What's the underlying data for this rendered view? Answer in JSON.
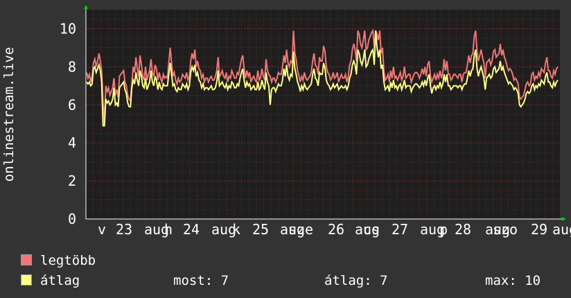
{
  "chart_data": {
    "type": "line",
    "ylabel": "onlinestream.live",
    "ylim": [
      0,
      11
    ],
    "y_ticks": [
      "0",
      "2",
      "4",
      "6",
      "8",
      "10"
    ],
    "x_ticks": [
      "v",
      "23",
      "aug",
      "h",
      "24",
      "aug",
      "k",
      "25",
      "aug",
      "sze",
      "26",
      "aug",
      "cs",
      "27",
      "aug",
      "p",
      "28",
      "aug",
      "szo",
      "29",
      "aug"
    ],
    "grid": true,
    "colors": {
      "background": "#333333",
      "plot": "#1e1e1e",
      "grid": "#5a2a2a",
      "axis": "#ffffff",
      "arrow": "#00cc00"
    },
    "series": [
      {
        "name": "legtöbb",
        "color": "#f07878",
        "values": [
          7.7,
          7.4,
          7.6,
          7.2,
          7.5,
          8.2,
          8.4,
          8.0,
          8.3,
          8.7,
          8.3,
          7.8,
          6.1,
          5.1,
          7.0,
          6.7,
          6.9,
          6.5,
          6.7,
          6.9,
          7.4,
          6.5,
          6.8,
          6.4,
          7.5,
          7.6,
          7.7,
          7.8,
          7.2,
          7.0,
          6.5,
          6.3,
          6.2,
          7.1,
          8.0,
          7.7,
          8.5,
          7.9,
          7.5,
          8.6,
          8.1,
          7.5,
          7.3,
          8.0,
          7.3,
          7.6,
          7.8,
          8.4,
          7.7,
          7.5,
          8.1,
          7.9,
          7.3,
          7.7,
          7.4,
          7.2,
          7.6,
          7.4,
          7.5,
          7.4,
          8.2,
          9.0,
          8.2,
          7.5,
          7.7,
          7.3,
          7.1,
          7.4,
          7.2,
          7.3,
          7.6,
          7.5,
          7.4,
          7.7,
          7.3,
          7.5,
          8.3,
          8.7,
          8.4,
          8.9,
          8.0,
          8.3,
          7.9,
          7.8,
          7.4,
          7.6,
          7.2,
          7.4,
          7.4,
          7.2,
          7.4,
          7.5,
          7.3,
          7.3,
          7.5,
          7.8,
          8.5,
          7.5,
          7.6,
          7.8,
          7.5,
          7.4,
          7.7,
          7.2,
          7.5,
          7.4,
          7.8,
          7.6,
          7.4,
          7.4,
          7.7,
          7.6,
          8.0,
          8.4,
          8.6,
          7.9,
          7.4,
          7.8,
          7.5,
          7.7,
          7.2,
          7.4,
          7.5,
          7.3,
          7.2,
          7.8,
          7.3,
          7.4,
          7.9,
          7.5,
          7.3,
          8.4,
          7.8,
          7.6,
          7.5,
          7.2,
          7.4,
          7.4,
          7.2,
          7.4,
          7.7,
          7.6,
          7.6,
          8.0,
          8.6,
          8.2,
          8.9,
          8.2,
          8.0,
          8.3,
          8.2,
          9.9,
          8.7,
          8.4,
          7.8,
          7.5,
          7.2,
          7.5,
          7.3,
          7.7,
          7.4,
          7.3,
          7.4,
          7.5,
          7.7,
          8.3,
          8.7,
          8.1,
          8.0,
          7.6,
          8.5,
          8.3,
          8.3,
          9.1,
          8.8,
          8.0,
          7.7,
          7.6,
          7.3,
          7.4,
          7.7,
          7.4,
          7.5,
          7.7,
          7.2,
          7.4,
          7.6,
          7.4,
          7.4,
          7.6,
          7.2,
          7.5,
          8.1,
          8.3,
          8.9,
          9.2,
          8.9,
          8.3,
          9.9,
          9.7,
          9.2,
          9.0,
          9.4,
          9.9,
          8.9,
          9.0,
          9.4,
          9.6,
          9.8,
          9.9,
          9.0,
          9.9,
          9.7,
          9.4,
          9.9,
          8.7,
          9.0,
          7.8,
          7.3,
          7.4,
          7.6,
          7.2,
          7.8,
          7.4,
          8.0,
          7.4,
          7.5,
          7.3,
          7.5,
          7.7,
          7.3,
          7.5,
          8.0,
          7.4,
          7.5,
          7.6,
          7.6,
          7.2,
          7.4,
          7.6,
          7.7,
          7.7,
          7.6,
          7.4,
          7.6,
          7.9,
          7.6,
          8.0,
          7.5,
          8.1,
          8.3,
          7.5,
          7.2,
          7.4,
          7.6,
          7.3,
          7.6,
          7.4,
          7.8,
          7.4,
          7.7,
          8.4,
          7.8,
          8.3,
          7.6,
          7.6,
          7.3,
          7.4,
          7.6,
          7.6,
          7.5,
          7.4,
          7.6,
          7.6,
          7.2,
          7.6,
          7.7,
          7.7,
          8.1,
          8.6,
          8.2,
          8.6,
          8.7,
          9.6,
          9.9,
          8.8,
          8.3,
          8.6,
          8.9,
          8.5,
          8.2,
          7.4,
          8.2,
          8.3,
          8.4,
          8.1,
          8.3,
          8.8,
          8.9,
          8.5,
          8.6,
          8.7,
          9.2,
          8.6,
          8.9,
          8.5,
          8.3,
          8.0,
          7.8,
          7.9,
          7.8,
          7.6,
          7.3,
          7.4,
          7.3,
          7.1,
          6.4,
          6.3,
          6.4,
          6.5,
          6.8,
          7.1,
          7.2,
          7.0,
          7.1,
          7.6,
          7.7,
          7.3,
          7.5,
          7.4,
          7.7,
          7.5,
          7.9,
          7.8,
          7.7,
          8.2,
          8.5,
          7.8,
          7.8,
          7.5,
          7.4,
          7.8,
          7.6,
          7.9,
          8.0
        ]
      },
      {
        "name": "átlag",
        "color": "#ffff88",
        "values": [
          7.2,
          7.1,
          7.2,
          7.0,
          7.1,
          7.9,
          8.0,
          7.7,
          7.9,
          8.1,
          7.8,
          7.2,
          4.9,
          4.9,
          6.3,
          6.1,
          6.2,
          6.0,
          6.1,
          6.3,
          6.9,
          6.0,
          6.1,
          5.9,
          6.9,
          7.0,
          7.1,
          7.2,
          6.8,
          6.6,
          6.1,
          5.9,
          5.9,
          6.9,
          7.3,
          7.1,
          7.7,
          7.3,
          7.0,
          7.8,
          7.5,
          7.0,
          6.9,
          7.4,
          6.8,
          7.0,
          7.2,
          7.8,
          7.2,
          7.0,
          7.5,
          7.3,
          6.8,
          7.2,
          6.9,
          6.8,
          7.1,
          7.0,
          7.0,
          7.0,
          7.6,
          8.2,
          7.6,
          7.0,
          7.1,
          6.8,
          6.7,
          6.9,
          6.8,
          6.8,
          7.1,
          7.0,
          6.9,
          7.1,
          6.8,
          7.0,
          7.7,
          8.0,
          7.8,
          8.1,
          7.5,
          7.7,
          7.3,
          7.2,
          6.9,
          7.1,
          6.8,
          6.9,
          6.9,
          6.8,
          6.9,
          7.0,
          6.8,
          6.8,
          6.9,
          7.2,
          7.8,
          7.0,
          7.1,
          7.2,
          7.0,
          6.9,
          7.1,
          6.8,
          7.0,
          6.9,
          7.2,
          7.1,
          6.9,
          6.9,
          7.1,
          7.0,
          7.4,
          7.7,
          7.9,
          7.3,
          6.9,
          7.2,
          7.0,
          7.1,
          6.8,
          6.9,
          7.0,
          6.8,
          6.8,
          7.2,
          6.8,
          6.9,
          7.3,
          7.0,
          6.8,
          7.7,
          7.2,
          7.0,
          6.0,
          6.8,
          6.9,
          6.9,
          6.7,
          6.9,
          7.1,
          7.0,
          7.0,
          7.3,
          7.9,
          7.5,
          8.1,
          7.5,
          7.3,
          7.6,
          7.5,
          8.8,
          7.9,
          7.6,
          7.2,
          7.0,
          6.7,
          7.0,
          6.8,
          7.1,
          6.9,
          6.8,
          6.9,
          7.0,
          7.1,
          7.6,
          7.9,
          7.4,
          7.3,
          7.0,
          7.7,
          7.6,
          7.6,
          8.2,
          7.9,
          7.3,
          7.1,
          7.0,
          6.8,
          6.9,
          7.1,
          6.9,
          7.0,
          7.1,
          6.8,
          6.9,
          7.0,
          6.9,
          6.9,
          7.0,
          6.8,
          7.0,
          7.4,
          7.6,
          8.1,
          8.3,
          8.1,
          7.6,
          8.9,
          8.7,
          8.3,
          8.1,
          8.4,
          8.9,
          8.0,
          8.1,
          8.4,
          8.6,
          8.8,
          8.9,
          8.1,
          9.9,
          9.0,
          8.5,
          8.9,
          7.9,
          8.1,
          7.2,
          6.8,
          6.9,
          7.0,
          6.7,
          7.2,
          6.9,
          7.3,
          6.9,
          7.0,
          6.8,
          7.0,
          7.1,
          6.8,
          7.0,
          7.3,
          6.9,
          7.0,
          7.0,
          7.0,
          6.7,
          6.9,
          7.0,
          7.1,
          7.1,
          7.0,
          6.9,
          7.0,
          7.2,
          7.0,
          7.3,
          7.0,
          7.4,
          7.6,
          7.0,
          6.6,
          6.9,
          7.0,
          6.8,
          7.0,
          6.9,
          7.2,
          6.9,
          7.1,
          7.6,
          7.2,
          7.6,
          7.0,
          7.0,
          6.8,
          6.9,
          7.0,
          7.0,
          7.0,
          6.9,
          7.0,
          7.0,
          6.8,
          7.0,
          7.1,
          7.1,
          7.4,
          7.8,
          7.5,
          7.8,
          7.9,
          8.6,
          8.9,
          7.9,
          7.5,
          7.8,
          8.0,
          7.7,
          7.4,
          6.8,
          7.4,
          7.5,
          7.6,
          7.4,
          7.5,
          7.9,
          8.0,
          7.7,
          7.8,
          7.9,
          8.3,
          7.8,
          8.0,
          7.7,
          7.5,
          7.3,
          7.1,
          7.2,
          7.1,
          7.0,
          6.8,
          6.9,
          6.8,
          6.6,
          6.0,
          5.9,
          6.0,
          6.1,
          6.3,
          6.6,
          6.7,
          6.6,
          6.7,
          7.0,
          7.1,
          6.8,
          7.0,
          6.9,
          7.1,
          7.0,
          7.3,
          7.2,
          7.1,
          7.5,
          7.7,
          7.2,
          7.2,
          7.0,
          6.9,
          7.2,
          7.0,
          7.2,
          7.3
        ]
      }
    ]
  },
  "legend": {
    "items": [
      {
        "label": "legtöbb",
        "color": "#f07878"
      },
      {
        "label": "átlag",
        "color": "#ffff88"
      }
    ],
    "stats": {
      "current_label": "most:",
      "current_value": "7",
      "average_label": "átlag:",
      "average_value": "7",
      "max_label": "max:",
      "max_value": "10"
    }
  }
}
